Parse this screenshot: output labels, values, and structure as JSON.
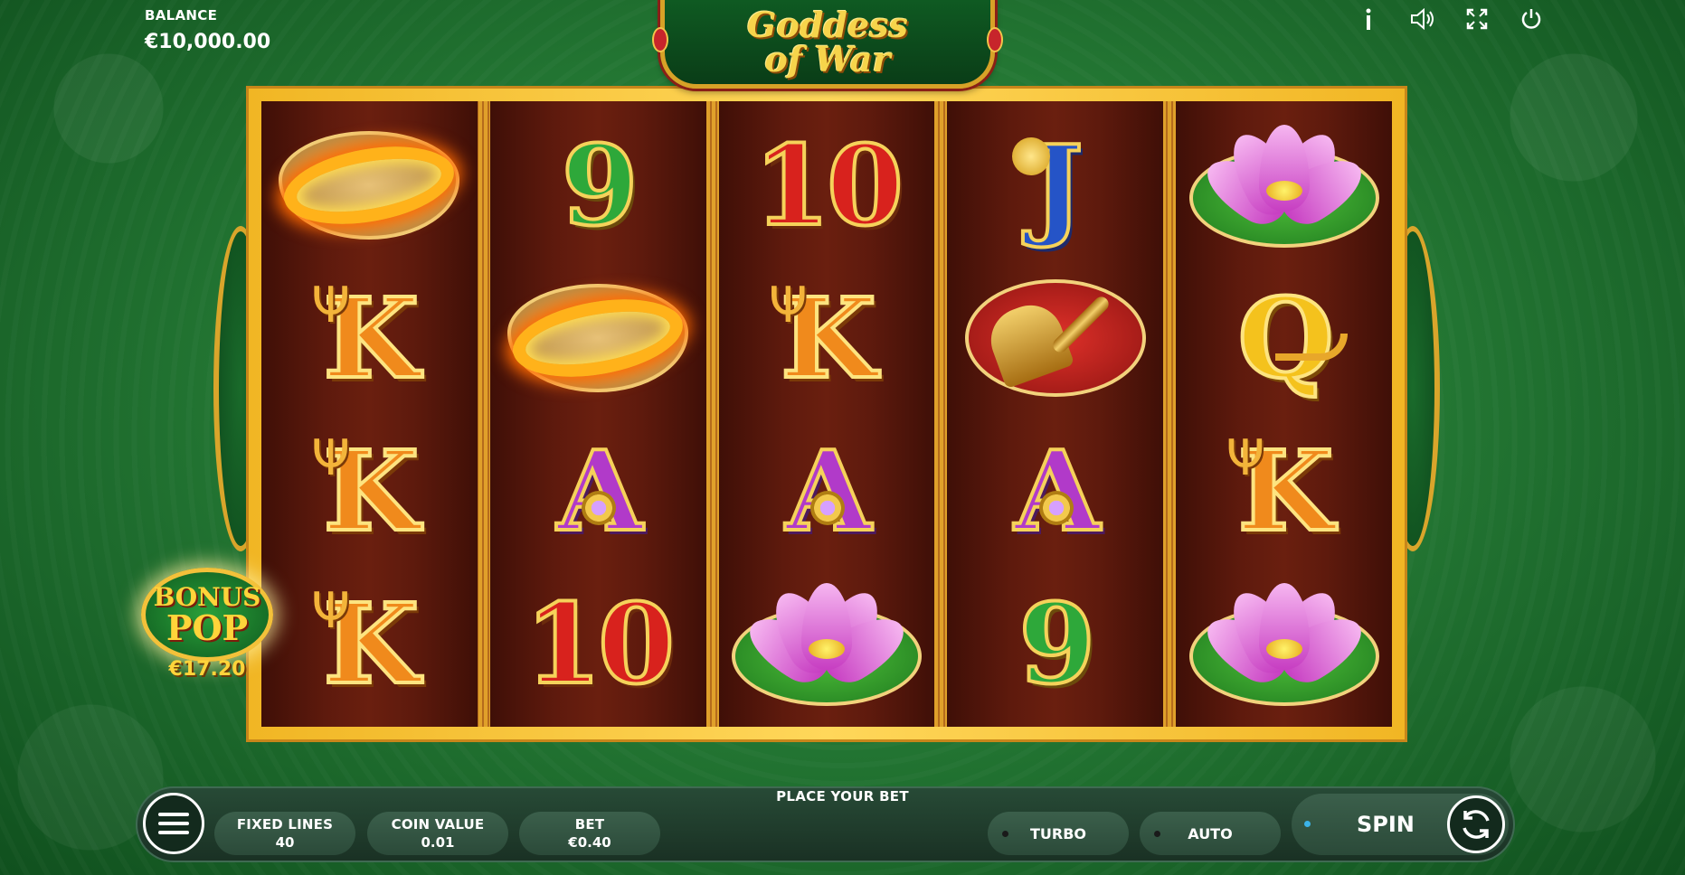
{
  "hud": {
    "balance_label": "BALANCE",
    "balance_value": "€10,000.00",
    "icons": [
      "info-icon",
      "sound-icon",
      "fullscreen-icon",
      "power-icon"
    ]
  },
  "logo": {
    "line1": "Goddess",
    "line2": "of War"
  },
  "reels": [
    [
      "fire-ring",
      "K",
      "K",
      "K"
    ],
    [
      "9",
      "fire-ring",
      "A",
      "10"
    ],
    [
      "10",
      "K",
      "A",
      "lotus"
    ],
    [
      "J",
      "bell",
      "A",
      "9"
    ],
    [
      "lotus",
      "Q",
      "K",
      "lotus"
    ]
  ],
  "bonus_pop": {
    "line1": "BONUS",
    "line2": "POP",
    "amount": "€17.20"
  },
  "controls": {
    "status_text": "PLACE YOUR BET",
    "fixed_lines_label": "FIXED LINES",
    "fixed_lines_value": "40",
    "coin_value_label": "COIN VALUE",
    "coin_value_value": "0.01",
    "bet_label": "BET",
    "bet_value": "€0.40",
    "turbo_label": "TURBO",
    "auto_label": "AUTO",
    "spin_label": "SPIN"
  },
  "colors": {
    "background": "#257a35",
    "frame_gold": "#f1b624",
    "reel_bg": "#5e1a0d",
    "control_bar": "#1a3124",
    "spin_indicator": "#3bb3e8"
  }
}
